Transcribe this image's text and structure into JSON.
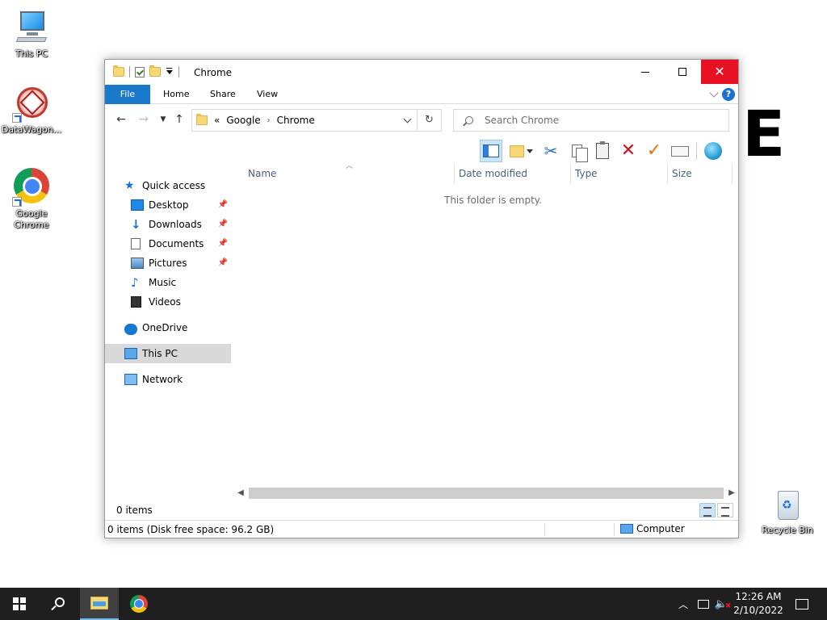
{
  "desktop": {
    "icons": [
      {
        "label": "This PC"
      },
      {
        "label": "DataWagon..."
      },
      {
        "label": "Google Chrome"
      },
      {
        "label": "Recycle Bin"
      }
    ],
    "overlay_letter": "E"
  },
  "window": {
    "title": "Chrome",
    "controls": {
      "minimize": "minimize-icon",
      "maximize": "maximize-icon",
      "close": "close-icon"
    },
    "ribbon": {
      "tabs": [
        "File",
        "Home",
        "Share",
        "View"
      ],
      "help": "?"
    },
    "address": {
      "overflow": "«",
      "breadcrumbs": [
        "Google",
        "Chrome"
      ],
      "separator": "›"
    },
    "search": {
      "placeholder": "Search Chrome"
    },
    "toolbar_icons": [
      "preview-pane-icon",
      "new-folder-icon",
      "cut-icon",
      "copy-icon",
      "paste-icon",
      "delete-icon",
      "properties-icon",
      "rename-icon",
      "shell-icon"
    ],
    "nav": {
      "quick_access": "Quick access",
      "pinned": [
        "Desktop",
        "Downloads",
        "Documents",
        "Pictures"
      ],
      "unpinned": [
        "Music",
        "Videos"
      ],
      "onedrive": "OneDrive",
      "this_pc": "This PC",
      "network": "Network"
    },
    "columns": [
      "Name",
      "Date modified",
      "Type",
      "Size"
    ],
    "empty_message": "This folder is empty.",
    "items_count": "0 items",
    "status": {
      "left": "0 items (Disk free space: 96.2 GB)",
      "right": "Computer"
    }
  },
  "taskbar": {
    "time": "12:26 AM",
    "date": "2/10/2022"
  },
  "colors": {
    "file_tab": "#1979ca",
    "close_button": "#e81123",
    "taskbar": "#1f1f1f",
    "selection": "#d9d9d9"
  }
}
